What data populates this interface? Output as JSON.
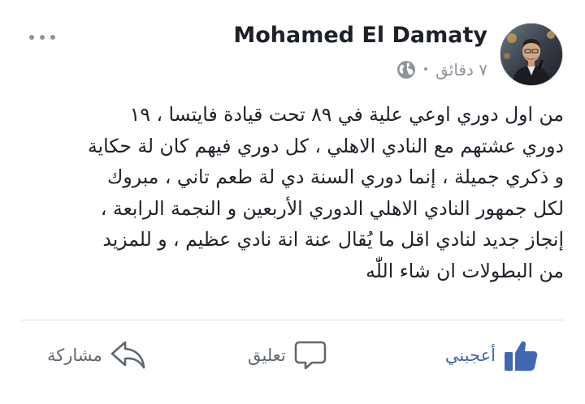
{
  "post": {
    "author": "Mohamed El Damaty",
    "time": "٧ دقائق",
    "separator": "•",
    "privacy_icon": "globe-icon",
    "text": "من اول دوري اوعي علية في ٨٩ تحت قيادة فايتسا ، ١٩\nدوري عشتهم مع النادي الاهلي ، كل دوري فيهم كان لة حكاية\nو ذكري جميلة ، إنما دوري السنة دي لة طعم تاني ، مبروك\nلكل جمهور النادي الاهلي الدوري الأربعين و النجمة الرابعة ،\nإنجاز جديد لنادي اقل ما يُقال عنة انة نادي عظيم ، و للمزيد\nمن البطولات ان شاء اللّٰه"
  },
  "actions": {
    "like": {
      "label": "أعجبني",
      "icon": "thumbs-up-icon",
      "color": "#4267b2"
    },
    "comment": {
      "label": "تعليق",
      "icon": "comment-icon"
    },
    "share": {
      "label": "مشاركة",
      "icon": "share-icon"
    }
  },
  "menu_icon": "more-options-icon"
}
